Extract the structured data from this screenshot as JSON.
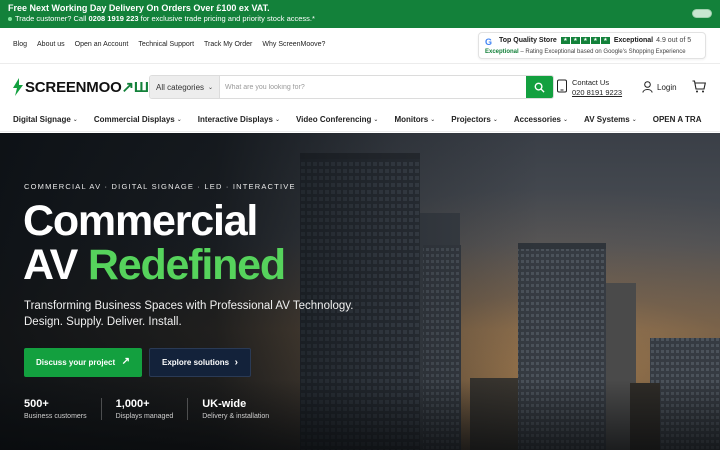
{
  "promo": {
    "headline": "Free Next Working Day Delivery On Orders Over £100 ex VAT.",
    "trade_prefix": "Trade customer? Call",
    "trade_phone": "0208 1919 223",
    "trade_suffix": "for exclusive trade pricing and priority stock access.*"
  },
  "utility_links": [
    "Blog",
    "About us",
    "Open an Account",
    "Technical Support",
    "Track My Order",
    "Why ScreenMoove?"
  ],
  "review": {
    "google_letter": "G",
    "store": "Top Quality Store",
    "rating_word": "Exceptional",
    "score": "4.9 out of 5",
    "caption_bold": "Exceptional",
    "caption": " – Rating Exceptional based on Google's Shopping Experience",
    "star_glyphs": [
      "★",
      "★",
      "★",
      "★",
      "★"
    ]
  },
  "header": {
    "logo_main": "SCREENMOO",
    "logo_accent": "↗Ш",
    "search_category": "All categories",
    "search_placeholder": "What are you looking for?",
    "contact_label": "Contact Us",
    "contact_phone": "020 8191 9223",
    "login_label": "Login"
  },
  "categories": [
    "Digital Signage",
    "Commercial Displays",
    "Interactive Displays",
    "Video Conferencing",
    "Monitors",
    "Projectors",
    "Accessories",
    "AV Systems",
    "OPEN A TRA"
  ],
  "hero": {
    "eyebrow": "COMMERCIAL AV · DIGITAL SIGNAGE · LED · INTERACTIVE",
    "title_line1": "Commercial",
    "title_line2_white": "AV ",
    "title_line2_green": "Redefined",
    "subtitle_line1": "Transforming Business Spaces with Professional AV Technology.",
    "subtitle_line2": "Design. Supply. Deliver. Install.",
    "primary_cta": "Discuss your project",
    "primary_cta_icon": "↗",
    "secondary_cta": "Explore solutions",
    "secondary_cta_icon": "›",
    "stats": [
      {
        "value": "500+",
        "label": "Business customers"
      },
      {
        "value": "1,000+",
        "label": "Displays managed"
      },
      {
        "value": "UK-wide",
        "label": "Delivery & installation"
      }
    ]
  },
  "colors": {
    "brand_green": "#13a03f",
    "promo_green": "#13813a",
    "accent_headline_green": "#56d35c",
    "navy_button": "#13223a"
  }
}
